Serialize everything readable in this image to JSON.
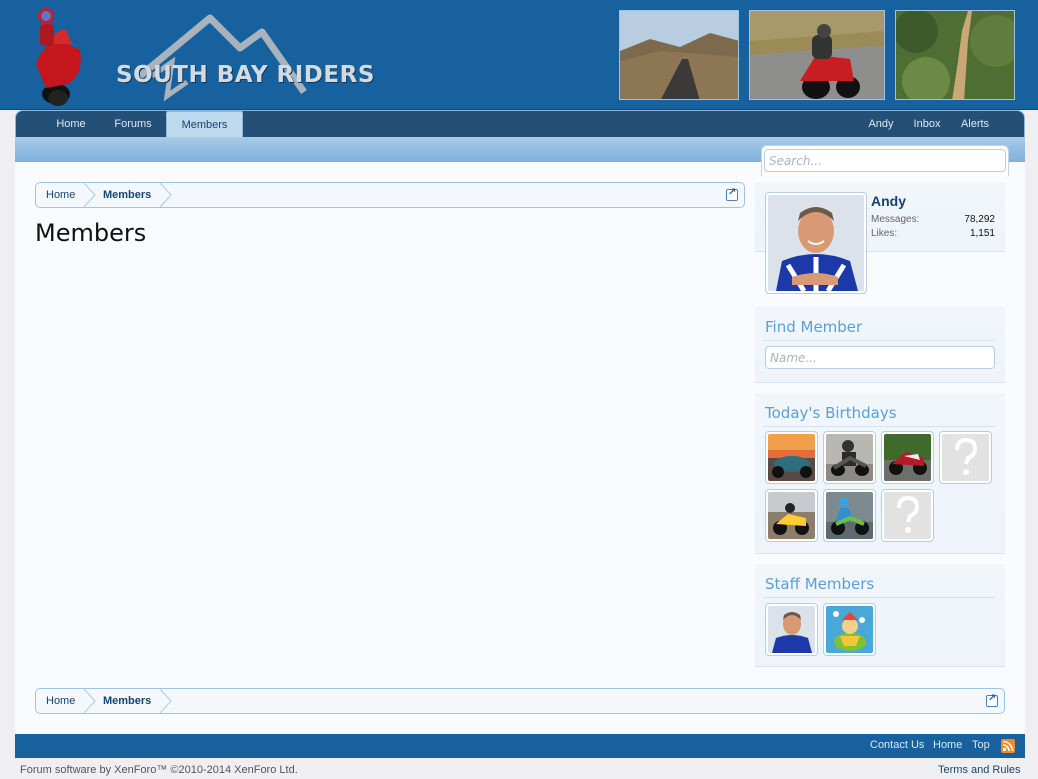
{
  "site": {
    "logo_text": "SOUTH BAY RIDERS"
  },
  "nav": {
    "tabs": [
      {
        "label": "Home"
      },
      {
        "label": "Forums"
      },
      {
        "label": "Members"
      }
    ],
    "user_links": [
      {
        "label": "Andy"
      },
      {
        "label": "Inbox"
      },
      {
        "label": "Alerts"
      }
    ]
  },
  "search": {
    "placeholder": "Search..."
  },
  "breadcrumb": {
    "items": [
      {
        "label": "Home"
      },
      {
        "label": "Members"
      }
    ]
  },
  "page": {
    "title": "Members"
  },
  "visitor": {
    "name": "Andy",
    "messages_label": "Messages:",
    "messages_value": "78,292",
    "likes_label": "Likes:",
    "likes_value": "1,151"
  },
  "find_member": {
    "heading": "Find Member",
    "placeholder": "Name..."
  },
  "birthdays": {
    "heading": "Today's Birthdays"
  },
  "staff": {
    "heading": "Staff Members"
  },
  "footer": {
    "links": [
      {
        "label": "Contact Us"
      },
      {
        "label": "Home"
      },
      {
        "label": "Top"
      }
    ],
    "copyright": "Forum software by XenForo™ ©2010-2014 XenForo Ltd.",
    "terms": "Terms and Rules"
  },
  "colors": {
    "header_blue": "#17629e",
    "nav_dark": "#244f76",
    "selected_tab": "#bfd9ef",
    "heading_blue": "#5aa0d7",
    "link_blue": "#17446e",
    "rss_orange": "#f08a24"
  }
}
